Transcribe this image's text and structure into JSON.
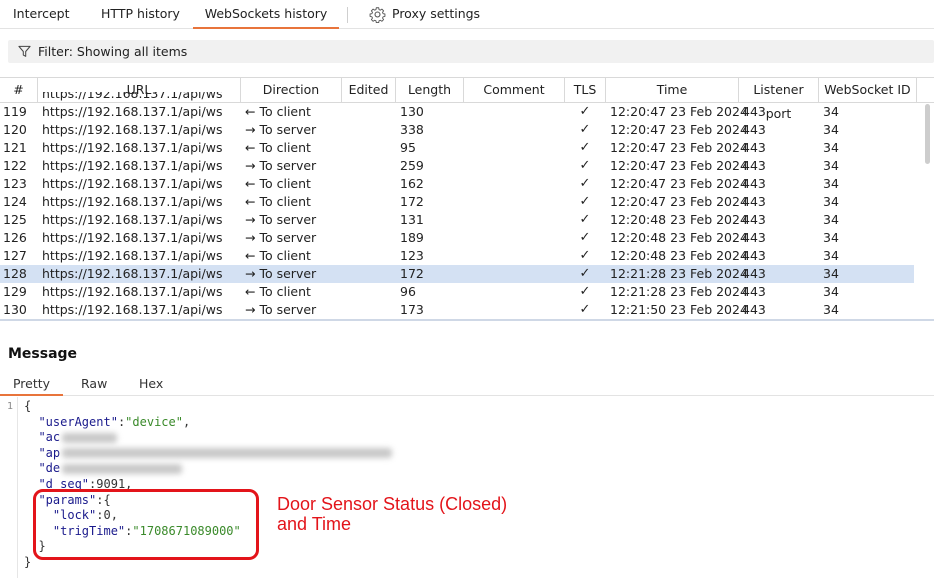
{
  "tabs": {
    "intercept": "Intercept",
    "http_history": "HTTP history",
    "websockets_history": "WebSockets history",
    "proxy_settings": "Proxy settings"
  },
  "filter": {
    "label": "Filter: Showing all items"
  },
  "table": {
    "columns": [
      "#",
      "URL",
      "Direction",
      "Edited",
      "Length",
      "Comment",
      "TLS",
      "Time",
      "Listener port",
      "WebSocket ID"
    ],
    "rows": [
      {
        "num": "119",
        "url": "https://192.168.137.1/api/ws",
        "dir_arrow": "←",
        "dir": "To client",
        "len": "130",
        "tls": "✓",
        "time": "12:20:47 23 Feb 2024",
        "port": "443",
        "wsid": "34"
      },
      {
        "num": "120",
        "url": "https://192.168.137.1/api/ws",
        "dir_arrow": "→",
        "dir": "To server",
        "len": "338",
        "tls": "✓",
        "time": "12:20:47 23 Feb 2024",
        "port": "443",
        "wsid": "34"
      },
      {
        "num": "121",
        "url": "https://192.168.137.1/api/ws",
        "dir_arrow": "←",
        "dir": "To client",
        "len": "95",
        "tls": "✓",
        "time": "12:20:47 23 Feb 2024",
        "port": "443",
        "wsid": "34"
      },
      {
        "num": "122",
        "url": "https://192.168.137.1/api/ws",
        "dir_arrow": "→",
        "dir": "To server",
        "len": "259",
        "tls": "✓",
        "time": "12:20:47 23 Feb 2024",
        "port": "443",
        "wsid": "34"
      },
      {
        "num": "123",
        "url": "https://192.168.137.1/api/ws",
        "dir_arrow": "←",
        "dir": "To client",
        "len": "162",
        "tls": "✓",
        "time": "12:20:47 23 Feb 2024",
        "port": "443",
        "wsid": "34"
      },
      {
        "num": "124",
        "url": "https://192.168.137.1/api/ws",
        "dir_arrow": "←",
        "dir": "To client",
        "len": "172",
        "tls": "✓",
        "time": "12:20:47 23 Feb 2024",
        "port": "443",
        "wsid": "34"
      },
      {
        "num": "125",
        "url": "https://192.168.137.1/api/ws",
        "dir_arrow": "→",
        "dir": "To server",
        "len": "131",
        "tls": "✓",
        "time": "12:20:48 23 Feb 2024",
        "port": "443",
        "wsid": "34"
      },
      {
        "num": "126",
        "url": "https://192.168.137.1/api/ws",
        "dir_arrow": "→",
        "dir": "To server",
        "len": "189",
        "tls": "✓",
        "time": "12:20:48 23 Feb 2024",
        "port": "443",
        "wsid": "34"
      },
      {
        "num": "127",
        "url": "https://192.168.137.1/api/ws",
        "dir_arrow": "←",
        "dir": "To client",
        "len": "123",
        "tls": "✓",
        "time": "12:20:48 23 Feb 2024",
        "port": "443",
        "wsid": "34"
      },
      {
        "num": "128",
        "url": "https://192.168.137.1/api/ws",
        "dir_arrow": "→",
        "dir": "To server",
        "len": "172",
        "tls": "✓",
        "time": "12:21:28 23 Feb 2024",
        "port": "443",
        "wsid": "34",
        "selected": true
      },
      {
        "num": "129",
        "url": "https://192.168.137.1/api/ws",
        "dir_arrow": "←",
        "dir": "To client",
        "len": "96",
        "tls": "✓",
        "time": "12:21:28 23 Feb 2024",
        "port": "443",
        "wsid": "34"
      },
      {
        "num": "130",
        "url": "https://192.168.137.1/api/ws",
        "dir_arrow": "→",
        "dir": "To server",
        "len": "173",
        "tls": "✓",
        "time": "12:21:50 23 Feb 2024",
        "port": "443",
        "wsid": "34"
      }
    ]
  },
  "message": {
    "title": "Message",
    "tabs": {
      "pretty": "Pretty",
      "raw": "Raw",
      "hex": "Hex"
    },
    "line_number": "1",
    "code": {
      "open_brace": "{",
      "user_agent_key": "\"userAgent\"",
      "user_agent_value": "\"device\"",
      "line3_visible": "\"ac",
      "line4_visible": "\"ap",
      "line5_visible": "\"de",
      "d_seq_key": "\"d_seq\"",
      "d_seq_value": "9091",
      "params_key": "\"params\"",
      "lock_key": "\"lock\"",
      "lock_value": "0",
      "trig_key": "\"trigTime\"",
      "trig_value": "\"1708671089000\"",
      "inner_close": "}",
      "close_brace": "}"
    }
  },
  "annotation": {
    "line1": "Door Sensor Status (Closed)",
    "line2": "and Time"
  },
  "colors": {
    "accent": "#e8743b",
    "selected_row": "#d4e1f3",
    "annotation": "#e3141a",
    "json_key": "#1a1a8c",
    "json_string": "#3a8a2a"
  }
}
